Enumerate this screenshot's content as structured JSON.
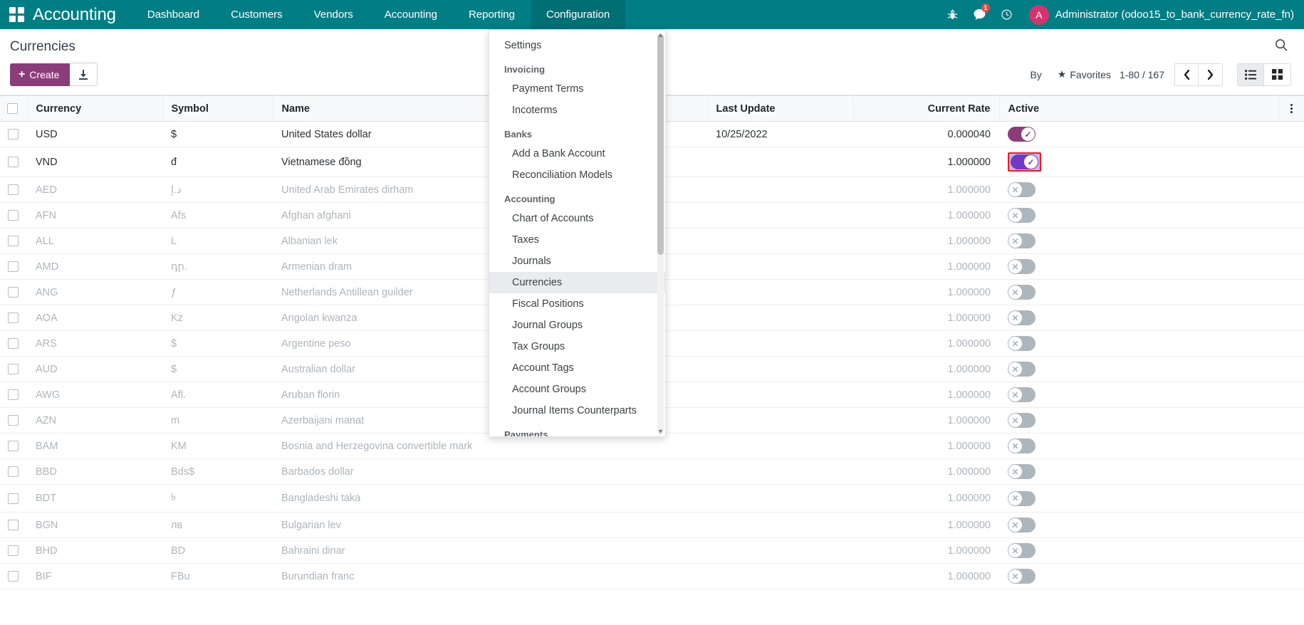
{
  "navbar": {
    "apps_icon": "apps-grid-icon",
    "brand": "Accounting",
    "menus": [
      {
        "label": "Dashboard",
        "open": false
      },
      {
        "label": "Customers",
        "open": false
      },
      {
        "label": "Vendors",
        "open": false
      },
      {
        "label": "Accounting",
        "open": false
      },
      {
        "label": "Reporting",
        "open": false
      },
      {
        "label": "Configuration",
        "open": true
      }
    ],
    "icons": [
      {
        "name": "debug-bug-icon",
        "glyph": "☣"
      },
      {
        "name": "messaging-icon",
        "glyph": "💬",
        "badge": "1"
      },
      {
        "name": "activities-clock-icon",
        "glyph": "◴"
      }
    ],
    "avatar_letter": "A",
    "user_name": "Administrator (odoo15_to_bank_currency_rate_fn)",
    "accent_color": "#017e84",
    "badge_color": "#e84c3d",
    "avatar_color": "#d6336c"
  },
  "control_panel": {
    "breadcrumb": "Currencies",
    "search_icon": "search-icon",
    "create_label": "Create",
    "create_plus": "+",
    "import_icon": "import-download-icon",
    "group_by_label": "By",
    "favorites_label": "Favorites",
    "favorites_star": "★",
    "pager": "1-80 / 167",
    "prev_arrow": "‹",
    "next_arrow": "›",
    "view_list_icon": "list-view-icon",
    "view_kanban_icon": "kanban-view-icon",
    "create_color": "#8b3d7a"
  },
  "dropdown": {
    "title": "Configuration",
    "groups": [
      {
        "section": null,
        "items": [
          {
            "label": "Settings",
            "root": true,
            "active": false
          }
        ]
      },
      {
        "section": "Invoicing",
        "items": [
          {
            "label": "Payment Terms",
            "root": false,
            "active": false
          },
          {
            "label": "Incoterms",
            "root": false,
            "active": false
          }
        ]
      },
      {
        "section": "Banks",
        "items": [
          {
            "label": "Add a Bank Account",
            "root": false,
            "active": false
          },
          {
            "label": "Reconciliation Models",
            "root": false,
            "active": false
          }
        ]
      },
      {
        "section": "Accounting",
        "items": [
          {
            "label": "Chart of Accounts",
            "root": false,
            "active": false
          },
          {
            "label": "Taxes",
            "root": false,
            "active": false
          },
          {
            "label": "Journals",
            "root": false,
            "active": false
          },
          {
            "label": "Currencies",
            "root": false,
            "active": true
          },
          {
            "label": "Fiscal Positions",
            "root": false,
            "active": false
          },
          {
            "label": "Journal Groups",
            "root": false,
            "active": false
          },
          {
            "label": "Tax Groups",
            "root": false,
            "active": false
          },
          {
            "label": "Account Tags",
            "root": false,
            "active": false
          },
          {
            "label": "Account Groups",
            "root": false,
            "active": false
          },
          {
            "label": "Journal Items Counterparts",
            "root": false,
            "active": false
          }
        ]
      },
      {
        "section": "Payments",
        "items": []
      }
    ]
  },
  "table": {
    "columns": [
      {
        "label": "Currency",
        "align": "left"
      },
      {
        "label": "Symbol",
        "align": "left"
      },
      {
        "label": "Name",
        "align": "left"
      },
      {
        "label": "Last Update",
        "align": "left"
      },
      {
        "label": "Current Rate",
        "align": "right"
      },
      {
        "label": "Active",
        "align": "left"
      }
    ],
    "optional_columns_icon": "vertical-dots-icon",
    "rows": [
      {
        "currency": "USD",
        "symbol": "$",
        "name": "United States dollar",
        "last_update": "10/25/2022",
        "rate": "0.000040",
        "active": true,
        "inactive_style": false,
        "toggle_state": "on"
      },
      {
        "currency": "VND",
        "symbol": "đ",
        "name": "Vietnamese đồng",
        "last_update": "",
        "rate": "1.000000",
        "active": true,
        "inactive_style": false,
        "toggle_state": "sel",
        "highlighted": true
      },
      {
        "currency": "AED",
        "symbol": "د.إ",
        "name": "United Arab Emirates dirham",
        "last_update": "",
        "rate": "1.000000",
        "active": false,
        "inactive_style": true,
        "toggle_state": "off"
      },
      {
        "currency": "AFN",
        "symbol": "Afs",
        "name": "Afghan afghani",
        "last_update": "",
        "rate": "1.000000",
        "active": false,
        "inactive_style": true,
        "toggle_state": "off"
      },
      {
        "currency": "ALL",
        "symbol": "L",
        "name": "Albanian lek",
        "last_update": "",
        "rate": "1.000000",
        "active": false,
        "inactive_style": true,
        "toggle_state": "off"
      },
      {
        "currency": "AMD",
        "symbol": "դր.",
        "name": "Armenian dram",
        "last_update": "",
        "rate": "1.000000",
        "active": false,
        "inactive_style": true,
        "toggle_state": "off"
      },
      {
        "currency": "ANG",
        "symbol": "ƒ",
        "name": "Netherlands Antillean guilder",
        "last_update": "",
        "rate": "1.000000",
        "active": false,
        "inactive_style": true,
        "toggle_state": "off"
      },
      {
        "currency": "AOA",
        "symbol": "Kz",
        "name": "Angolan kwanza",
        "last_update": "",
        "rate": "1.000000",
        "active": false,
        "inactive_style": true,
        "toggle_state": "off"
      },
      {
        "currency": "ARS",
        "symbol": "$",
        "name": "Argentine peso",
        "last_update": "",
        "rate": "1.000000",
        "active": false,
        "inactive_style": true,
        "toggle_state": "off"
      },
      {
        "currency": "AUD",
        "symbol": "$",
        "name": "Australian dollar",
        "last_update": "",
        "rate": "1.000000",
        "active": false,
        "inactive_style": true,
        "toggle_state": "off"
      },
      {
        "currency": "AWG",
        "symbol": "Afl.",
        "name": "Aruban florin",
        "last_update": "",
        "rate": "1.000000",
        "active": false,
        "inactive_style": true,
        "toggle_state": "off"
      },
      {
        "currency": "AZN",
        "symbol": "m",
        "name": "Azerbaijani manat",
        "last_update": "",
        "rate": "1.000000",
        "active": false,
        "inactive_style": true,
        "toggle_state": "off"
      },
      {
        "currency": "BAM",
        "symbol": "KM",
        "name": "Bosnia and Herzegovina convertible mark",
        "last_update": "",
        "rate": "1.000000",
        "active": false,
        "inactive_style": true,
        "toggle_state": "off"
      },
      {
        "currency": "BBD",
        "symbol": "Bds$",
        "name": "Barbados dollar",
        "last_update": "",
        "rate": "1.000000",
        "active": false,
        "inactive_style": true,
        "toggle_state": "off"
      },
      {
        "currency": "BDT",
        "symbol": "৳",
        "name": "Bangladeshi taka",
        "last_update": "",
        "rate": "1.000000",
        "active": false,
        "inactive_style": true,
        "toggle_state": "off"
      },
      {
        "currency": "BGN",
        "symbol": "лв",
        "name": "Bulgarian lev",
        "last_update": "",
        "rate": "1.000000",
        "active": false,
        "inactive_style": true,
        "toggle_state": "off"
      },
      {
        "currency": "BHD",
        "symbol": "BD",
        "name": "Bahraini dinar",
        "last_update": "",
        "rate": "1.000000",
        "active": false,
        "inactive_style": true,
        "toggle_state": "off"
      },
      {
        "currency": "BIF",
        "symbol": "FBu",
        "name": "Burundian franc",
        "last_update": "",
        "rate": "1.000000",
        "active": false,
        "inactive_style": true,
        "toggle_state": "off"
      }
    ]
  }
}
